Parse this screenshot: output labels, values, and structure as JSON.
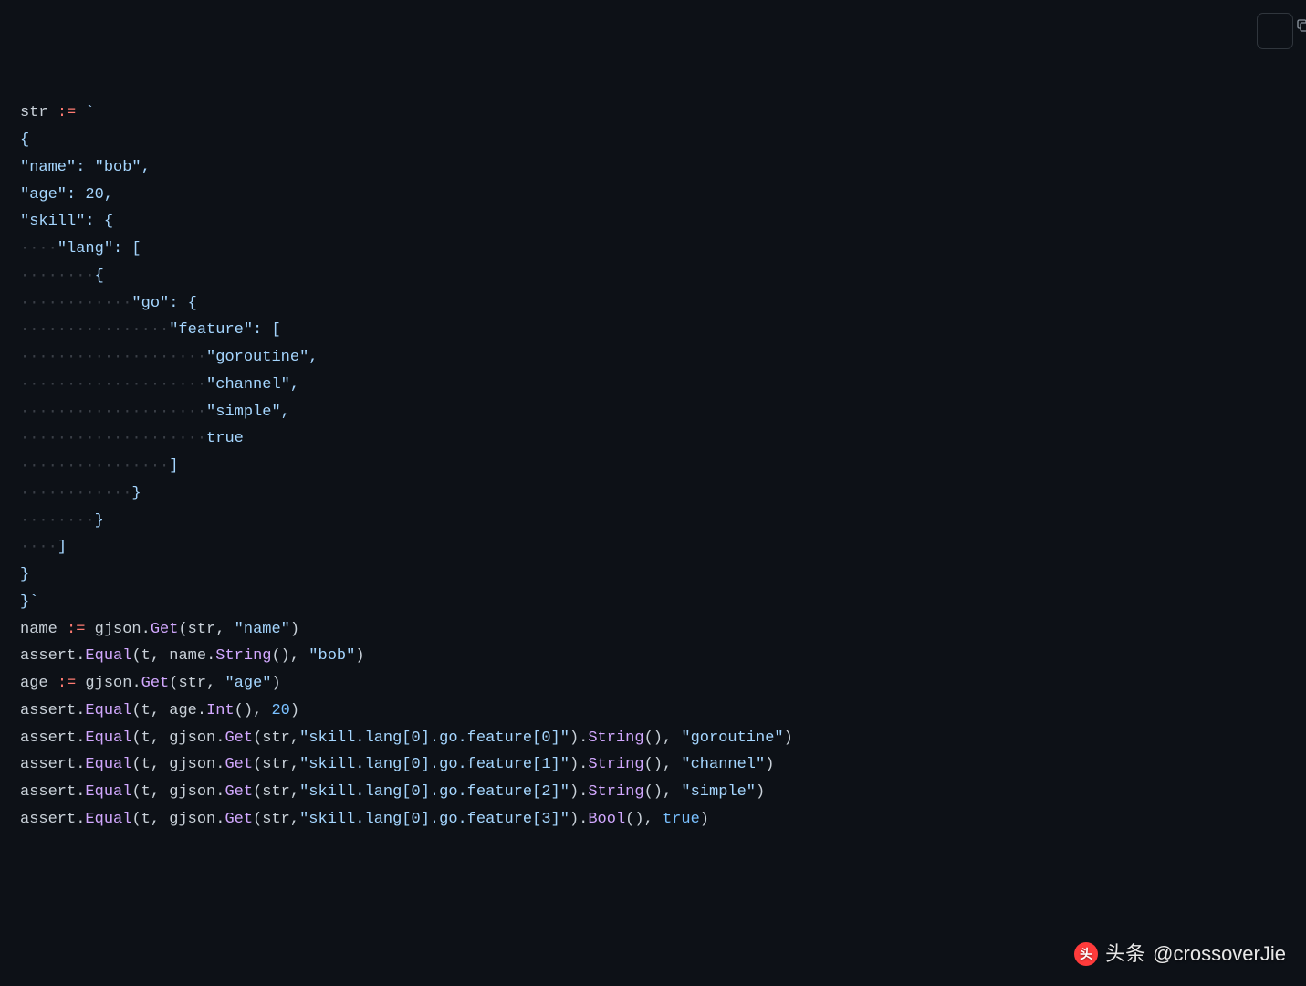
{
  "code": {
    "tokens": [
      {
        "cls": "tok-var",
        "txt": "str"
      },
      {
        "cls": "tok-plain",
        "txt": " "
      },
      {
        "cls": "tok-op",
        "txt": ":="
      },
      {
        "cls": "tok-plain",
        "txt": " "
      },
      {
        "cls": "tok-str",
        "txt": "`"
      },
      {
        "cls": "nl"
      },
      {
        "cls": "tok-str",
        "txt": "{"
      },
      {
        "cls": "nl"
      },
      {
        "cls": "tok-str",
        "txt": "\"name\": \"bob\","
      },
      {
        "cls": "nl"
      },
      {
        "cls": "tok-str",
        "txt": "\"age\": 20,"
      },
      {
        "cls": "nl"
      },
      {
        "cls": "tok-str",
        "txt": "\"skill\": {"
      },
      {
        "cls": "nl"
      },
      {
        "cls": "leading-dots",
        "txt": "····"
      },
      {
        "cls": "tok-str",
        "txt": "\"lang\": ["
      },
      {
        "cls": "nl"
      },
      {
        "cls": "leading-dots",
        "txt": "········"
      },
      {
        "cls": "tok-str",
        "txt": "{"
      },
      {
        "cls": "nl"
      },
      {
        "cls": "leading-dots",
        "txt": "············"
      },
      {
        "cls": "tok-str",
        "txt": "\"go\": {"
      },
      {
        "cls": "nl"
      },
      {
        "cls": "leading-dots",
        "txt": "················"
      },
      {
        "cls": "tok-str",
        "txt": "\"feature\": ["
      },
      {
        "cls": "nl"
      },
      {
        "cls": "leading-dots",
        "txt": "····················"
      },
      {
        "cls": "tok-str",
        "txt": "\"goroutine\","
      },
      {
        "cls": "nl"
      },
      {
        "cls": "leading-dots",
        "txt": "····················"
      },
      {
        "cls": "tok-str",
        "txt": "\"channel\","
      },
      {
        "cls": "nl"
      },
      {
        "cls": "leading-dots",
        "txt": "····················"
      },
      {
        "cls": "tok-str",
        "txt": "\"simple\","
      },
      {
        "cls": "nl"
      },
      {
        "cls": "leading-dots",
        "txt": "····················"
      },
      {
        "cls": "tok-str",
        "txt": "true"
      },
      {
        "cls": "nl"
      },
      {
        "cls": "leading-dots",
        "txt": "················"
      },
      {
        "cls": "tok-str",
        "txt": "]"
      },
      {
        "cls": "nl"
      },
      {
        "cls": "leading-dots",
        "txt": "············"
      },
      {
        "cls": "tok-str",
        "txt": "}"
      },
      {
        "cls": "nl"
      },
      {
        "cls": "leading-dots",
        "txt": "········"
      },
      {
        "cls": "tok-str",
        "txt": "}"
      },
      {
        "cls": "nl"
      },
      {
        "cls": "leading-dots",
        "txt": "····"
      },
      {
        "cls": "tok-str",
        "txt": "]"
      },
      {
        "cls": "nl"
      },
      {
        "cls": "tok-str",
        "txt": "}"
      },
      {
        "cls": "nl"
      },
      {
        "cls": "tok-str",
        "txt": "}`"
      },
      {
        "cls": "nl"
      },
      {
        "cls": "nl"
      },
      {
        "cls": "tok-var",
        "txt": "name"
      },
      {
        "cls": "tok-plain",
        "txt": " "
      },
      {
        "cls": "tok-op",
        "txt": ":="
      },
      {
        "cls": "tok-plain",
        "txt": " "
      },
      {
        "cls": "tok-var",
        "txt": "gjson"
      },
      {
        "cls": "tok-punc",
        "txt": "."
      },
      {
        "cls": "tok-call",
        "txt": "Get"
      },
      {
        "cls": "tok-punc",
        "txt": "("
      },
      {
        "cls": "tok-var",
        "txt": "str"
      },
      {
        "cls": "tok-punc",
        "txt": ", "
      },
      {
        "cls": "tok-str",
        "txt": "\"name\""
      },
      {
        "cls": "tok-punc",
        "txt": ")"
      },
      {
        "cls": "nl"
      },
      {
        "cls": "tok-var",
        "txt": "assert"
      },
      {
        "cls": "tok-punc",
        "txt": "."
      },
      {
        "cls": "tok-call",
        "txt": "Equal"
      },
      {
        "cls": "tok-punc",
        "txt": "("
      },
      {
        "cls": "tok-var",
        "txt": "t"
      },
      {
        "cls": "tok-punc",
        "txt": ", "
      },
      {
        "cls": "tok-var",
        "txt": "name"
      },
      {
        "cls": "tok-punc",
        "txt": "."
      },
      {
        "cls": "tok-call",
        "txt": "String"
      },
      {
        "cls": "tok-punc",
        "txt": "(), "
      },
      {
        "cls": "tok-str",
        "txt": "\"bob\""
      },
      {
        "cls": "tok-punc",
        "txt": ")"
      },
      {
        "cls": "nl"
      },
      {
        "cls": "nl"
      },
      {
        "cls": "tok-var",
        "txt": "age"
      },
      {
        "cls": "tok-plain",
        "txt": " "
      },
      {
        "cls": "tok-op",
        "txt": ":="
      },
      {
        "cls": "tok-plain",
        "txt": " "
      },
      {
        "cls": "tok-var",
        "txt": "gjson"
      },
      {
        "cls": "tok-punc",
        "txt": "."
      },
      {
        "cls": "tok-call",
        "txt": "Get"
      },
      {
        "cls": "tok-punc",
        "txt": "("
      },
      {
        "cls": "tok-var",
        "txt": "str"
      },
      {
        "cls": "tok-punc",
        "txt": ", "
      },
      {
        "cls": "tok-str",
        "txt": "\"age\""
      },
      {
        "cls": "tok-punc",
        "txt": ")"
      },
      {
        "cls": "nl"
      },
      {
        "cls": "tok-var",
        "txt": "assert"
      },
      {
        "cls": "tok-punc",
        "txt": "."
      },
      {
        "cls": "tok-call",
        "txt": "Equal"
      },
      {
        "cls": "tok-punc",
        "txt": "("
      },
      {
        "cls": "tok-var",
        "txt": "t"
      },
      {
        "cls": "tok-punc",
        "txt": ", "
      },
      {
        "cls": "tok-var",
        "txt": "age"
      },
      {
        "cls": "tok-punc",
        "txt": "."
      },
      {
        "cls": "tok-call",
        "txt": "Int"
      },
      {
        "cls": "tok-punc",
        "txt": "(), "
      },
      {
        "cls": "tok-num",
        "txt": "20"
      },
      {
        "cls": "tok-punc",
        "txt": ")"
      },
      {
        "cls": "nl"
      },
      {
        "cls": "nl"
      },
      {
        "cls": "tok-var",
        "txt": "assert"
      },
      {
        "cls": "tok-punc",
        "txt": "."
      },
      {
        "cls": "tok-call",
        "txt": "Equal"
      },
      {
        "cls": "tok-punc",
        "txt": "("
      },
      {
        "cls": "tok-var",
        "txt": "t"
      },
      {
        "cls": "tok-punc",
        "txt": ", "
      },
      {
        "cls": "tok-var",
        "txt": "gjson"
      },
      {
        "cls": "tok-punc",
        "txt": "."
      },
      {
        "cls": "tok-call",
        "txt": "Get"
      },
      {
        "cls": "tok-punc",
        "txt": "("
      },
      {
        "cls": "tok-var",
        "txt": "str"
      },
      {
        "cls": "tok-punc",
        "txt": ","
      },
      {
        "cls": "tok-str",
        "txt": "\"skill.lang[0].go.feature[0]\""
      },
      {
        "cls": "tok-punc",
        "txt": ")."
      },
      {
        "cls": "tok-call",
        "txt": "String"
      },
      {
        "cls": "tok-punc",
        "txt": "(), "
      },
      {
        "cls": "tok-str",
        "txt": "\"goroutine\""
      },
      {
        "cls": "tok-punc",
        "txt": ")"
      },
      {
        "cls": "nl"
      },
      {
        "cls": "tok-var",
        "txt": "assert"
      },
      {
        "cls": "tok-punc",
        "txt": "."
      },
      {
        "cls": "tok-call",
        "txt": "Equal"
      },
      {
        "cls": "tok-punc",
        "txt": "("
      },
      {
        "cls": "tok-var",
        "txt": "t"
      },
      {
        "cls": "tok-punc",
        "txt": ", "
      },
      {
        "cls": "tok-var",
        "txt": "gjson"
      },
      {
        "cls": "tok-punc",
        "txt": "."
      },
      {
        "cls": "tok-call",
        "txt": "Get"
      },
      {
        "cls": "tok-punc",
        "txt": "("
      },
      {
        "cls": "tok-var",
        "txt": "str"
      },
      {
        "cls": "tok-punc",
        "txt": ","
      },
      {
        "cls": "tok-str",
        "txt": "\"skill.lang[0].go.feature[1]\""
      },
      {
        "cls": "tok-punc",
        "txt": ")."
      },
      {
        "cls": "tok-call",
        "txt": "String"
      },
      {
        "cls": "tok-punc",
        "txt": "(), "
      },
      {
        "cls": "tok-str",
        "txt": "\"channel\""
      },
      {
        "cls": "tok-punc",
        "txt": ")"
      },
      {
        "cls": "nl"
      },
      {
        "cls": "tok-var",
        "txt": "assert"
      },
      {
        "cls": "tok-punc",
        "txt": "."
      },
      {
        "cls": "tok-call",
        "txt": "Equal"
      },
      {
        "cls": "tok-punc",
        "txt": "("
      },
      {
        "cls": "tok-var",
        "txt": "t"
      },
      {
        "cls": "tok-punc",
        "txt": ", "
      },
      {
        "cls": "tok-var",
        "txt": "gjson"
      },
      {
        "cls": "tok-punc",
        "txt": "."
      },
      {
        "cls": "tok-call",
        "txt": "Get"
      },
      {
        "cls": "tok-punc",
        "txt": "("
      },
      {
        "cls": "tok-var",
        "txt": "str"
      },
      {
        "cls": "tok-punc",
        "txt": ","
      },
      {
        "cls": "tok-str",
        "txt": "\"skill.lang[0].go.feature[2]\""
      },
      {
        "cls": "tok-punc",
        "txt": ")."
      },
      {
        "cls": "tok-call",
        "txt": "String"
      },
      {
        "cls": "tok-punc",
        "txt": "(), "
      },
      {
        "cls": "tok-str",
        "txt": "\"simple\""
      },
      {
        "cls": "tok-punc",
        "txt": ")"
      },
      {
        "cls": "nl"
      },
      {
        "cls": "tok-var",
        "txt": "assert"
      },
      {
        "cls": "tok-punc",
        "txt": "."
      },
      {
        "cls": "tok-call",
        "txt": "Equal"
      },
      {
        "cls": "tok-punc",
        "txt": "("
      },
      {
        "cls": "tok-var",
        "txt": "t"
      },
      {
        "cls": "tok-punc",
        "txt": ", "
      },
      {
        "cls": "tok-var",
        "txt": "gjson"
      },
      {
        "cls": "tok-punc",
        "txt": "."
      },
      {
        "cls": "tok-call",
        "txt": "Get"
      },
      {
        "cls": "tok-punc",
        "txt": "("
      },
      {
        "cls": "tok-var",
        "txt": "str"
      },
      {
        "cls": "tok-punc",
        "txt": ","
      },
      {
        "cls": "tok-str",
        "txt": "\"skill.lang[0].go.feature[3]\""
      },
      {
        "cls": "tok-punc",
        "txt": ")."
      },
      {
        "cls": "tok-call",
        "txt": "Bool"
      },
      {
        "cls": "tok-punc",
        "txt": "(), "
      },
      {
        "cls": "tok-bool",
        "txt": "true"
      },
      {
        "cls": "tok-punc",
        "txt": ")"
      }
    ]
  },
  "watermark": {
    "badge": "头",
    "prefix": "头条",
    "handle": "@crossoverJie"
  }
}
